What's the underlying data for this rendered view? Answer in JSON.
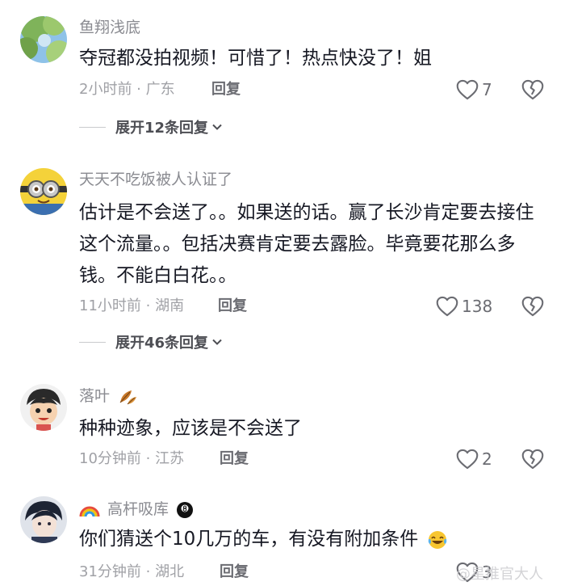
{
  "comments": [
    {
      "username": "鱼翔浅底",
      "text": "夺冠都没拍视频！可惜了！热点快没了！姐",
      "meta": "2小时前 · 广东",
      "reply": "回复",
      "likes": "7",
      "expand": "展开12条回复"
    },
    {
      "username": "天天不吃饭被人认证了",
      "text": "估计是不会送了。。如果送的话。赢了长沙肯定要去接住这个流量。。包括决赛肯定要去露脸。毕竟要花那么多钱。不能白白花。。",
      "meta": "11小时前 · 湖南",
      "reply": "回复",
      "likes": "138",
      "expand": "展开46条回复"
    },
    {
      "username": "落叶",
      "text": "种种迹象，应该是不会送了",
      "meta": "10分钟前 · 江苏",
      "reply": "回复",
      "likes": "2"
    },
    {
      "username": "高杆吸库",
      "text": "你们猜送个10几万的车，有没有附加条件",
      "meta": "31分钟前 · 湖北",
      "reply": "回复",
      "likes": "3"
    }
  ],
  "watermark": "@星推官大人",
  "icons": {
    "like": "heart-outline-icon",
    "dislike": "broken-heart-icon",
    "expand": "chevron-down-icon"
  }
}
